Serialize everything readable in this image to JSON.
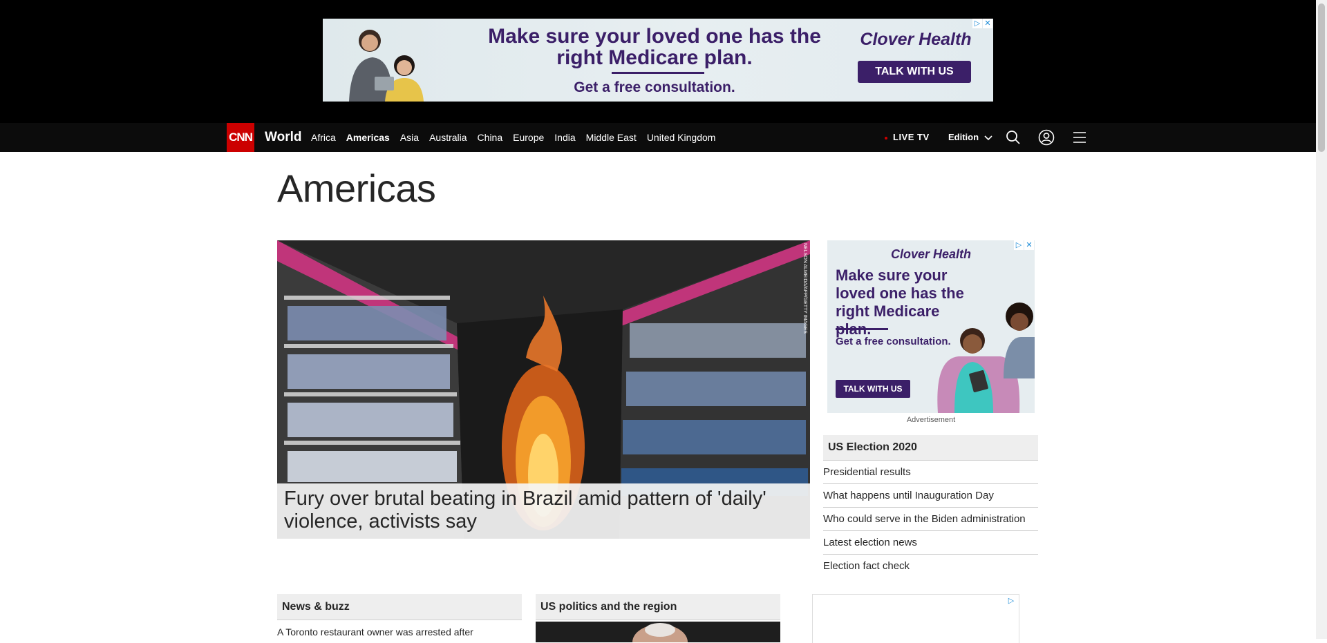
{
  "top_ad": {
    "headline": "Make sure your loved one has the right Medicare plan.",
    "subline": "Get a free consultation.",
    "brand": "Clover Health",
    "cta": "TALK WITH US",
    "adchoices_icon": "adchoices-icon",
    "close_icon": "close-icon",
    "brand_color": "#3b1f68"
  },
  "nav": {
    "logo": "CNN",
    "section": "World",
    "links": [
      "Africa",
      "Americas",
      "Asia",
      "Australia",
      "China",
      "Europe",
      "India",
      "Middle East",
      "United Kingdom"
    ],
    "active_link": "Americas",
    "live_tv": "LIVE TV",
    "edition": "Edition",
    "icons": [
      "search-icon",
      "account-icon",
      "menu-icon"
    ]
  },
  "page": {
    "title": "Americas"
  },
  "hero": {
    "headline": "Fury over brutal beating in Brazil amid pattern of 'daily' violence, activists say",
    "photo_credit": "NELSON ALMEIDA/AFP/GETTY IMAGES"
  },
  "side_ad": {
    "brand": "Clover Health",
    "headline": "Make sure your loved one has the right Medicare plan.",
    "subline": "Get a free consultation.",
    "cta": "TALK WITH US",
    "label": "Advertisement"
  },
  "election": {
    "title": "US Election 2020",
    "items": [
      "Presidential results",
      "What happens until Inauguration Day",
      "Who could serve in the Biden administration",
      "Latest election news",
      "Election fact check"
    ]
  },
  "sections": {
    "news_buzz": {
      "title": "News & buzz",
      "first_item": "A Toronto restaurant owner was arrested after"
    },
    "us_politics": {
      "title": "US politics and the region"
    }
  },
  "colors": {
    "cnn_red": "#cc0000",
    "nav_bg": "#0c0c0c"
  }
}
